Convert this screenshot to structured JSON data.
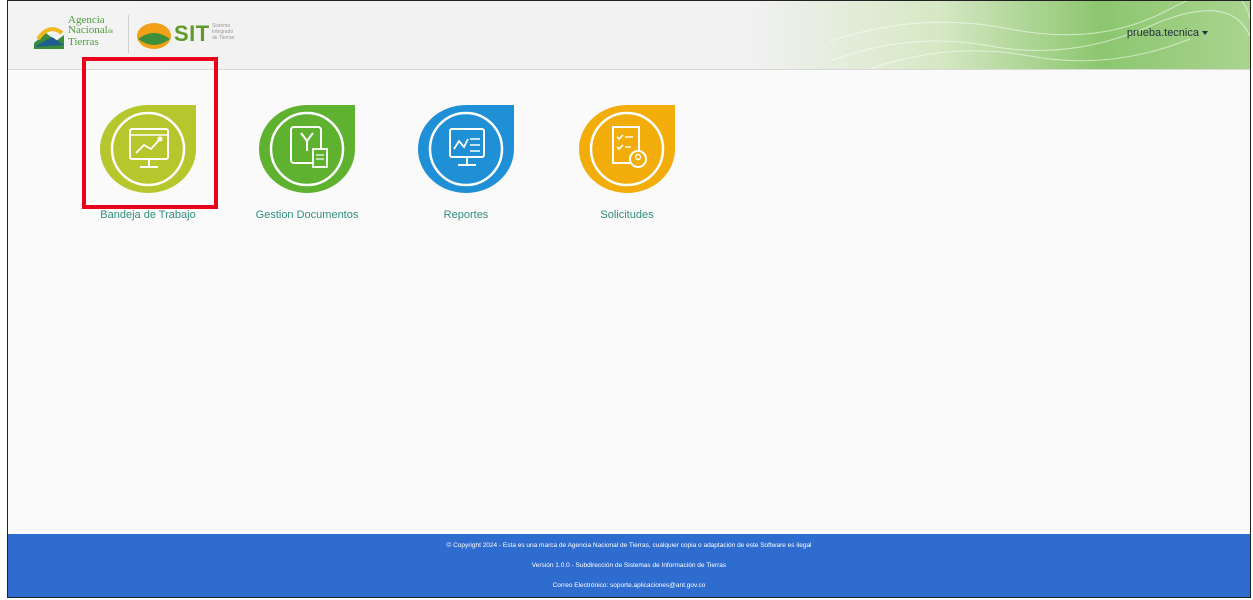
{
  "header": {
    "logo_ant": {
      "line1": "Agencia",
      "line2": "Nacional",
      "line2_suffix": "de",
      "line3": "Tierras"
    },
    "logo_sit": {
      "acronym": "SIT",
      "sub1": "Sistema",
      "sub2": "Integrado",
      "sub3": "de Tierras"
    },
    "user": "prueba.tecnica"
  },
  "tiles": [
    {
      "label": "Bandeja de Trabajo",
      "icon": "workspace-monitor-icon",
      "color": "#b5c72c"
    },
    {
      "label": "Gestion Documentos",
      "icon": "document-folder-icon",
      "color": "#5fb130"
    },
    {
      "label": "Reportes",
      "icon": "report-chart-icon",
      "color": "#1f8fd6"
    },
    {
      "label": "Solicitudes",
      "icon": "request-checklist-icon",
      "color": "#f2ad0a"
    }
  ],
  "footer": {
    "copyright": "© Copyright 2024 - Esta es una marca de Agencia Nacional de Tierras, cualquier copia o adaptación de este Software es ilegal",
    "version": "Versión 1.0.0 - Subdirección de Sistemas de Información de Tierras",
    "email": "Correo Electrónico: soporte.aplicaciones@ant.gov.co"
  },
  "colors": {
    "footer_bg": "#2f6ccf",
    "highlight": "#e8001c",
    "label": "#2f8f7d"
  }
}
